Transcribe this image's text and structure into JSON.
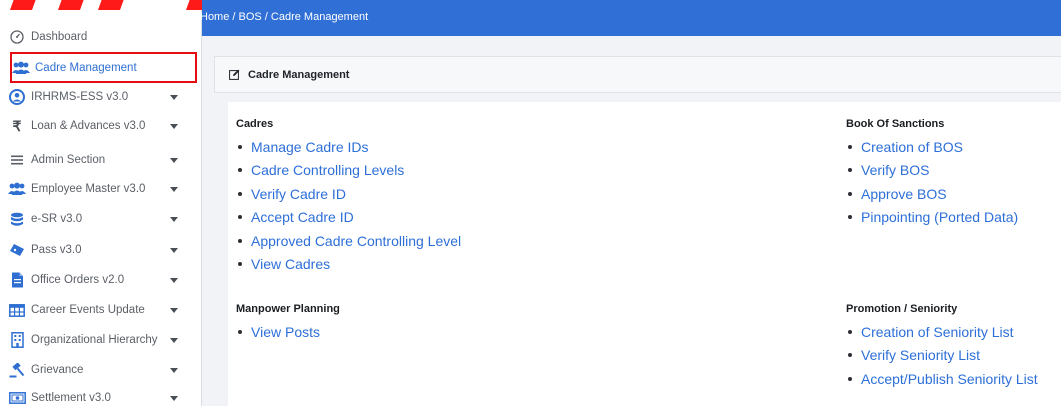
{
  "sidebar": {
    "items": [
      {
        "label": "Dashboard",
        "icon": "dashboard-icon",
        "has_caret": false,
        "active": false
      },
      {
        "label": "Cadre Management",
        "icon": "users-group-icon",
        "has_caret": false,
        "active": true
      },
      {
        "label": "IRHRMS-ESS v3.0",
        "icon": "user-circle-icon",
        "has_caret": true,
        "active": false
      },
      {
        "label": "Loan & Advances v3.0",
        "icon": "rupee-icon",
        "has_caret": true,
        "active": false
      },
      {
        "label": "Admin Section",
        "icon": "menu-bars-icon",
        "has_caret": true,
        "active": false
      },
      {
        "label": "Employee Master v3.0",
        "icon": "users-group-icon",
        "has_caret": true,
        "active": false
      },
      {
        "label": "e-SR v3.0",
        "icon": "database-icon",
        "has_caret": true,
        "active": false
      },
      {
        "label": "Pass v3.0",
        "icon": "ticket-icon",
        "has_caret": true,
        "active": false
      },
      {
        "label": "Office Orders v2.0",
        "icon": "file-icon",
        "has_caret": true,
        "active": false
      },
      {
        "label": "Career Events Update",
        "icon": "table-grid-icon",
        "has_caret": true,
        "active": false
      },
      {
        "label": "Organizational Hierarchy",
        "icon": "building-icon",
        "has_caret": true,
        "active": false
      },
      {
        "label": "Grievance",
        "icon": "gavel-icon",
        "has_caret": true,
        "active": false
      },
      {
        "label": "Settlement v3.0",
        "icon": "money-icon",
        "has_caret": true,
        "active": false
      }
    ]
  },
  "breadcrumb": "Home / BOS / Cadre Management",
  "panel": {
    "title": "Cadre Management",
    "icon": "edit-icon"
  },
  "sections": {
    "cadres": {
      "title": "Cadres",
      "links": [
        "Manage Cadre IDs",
        "Cadre Controlling Levels",
        "Verify Cadre ID",
        "Accept Cadre ID",
        "Approved Cadre Controlling Level",
        "View Cadres"
      ]
    },
    "book_of_sanctions": {
      "title": "Book Of Sanctions",
      "links": [
        "Creation of BOS",
        "Verify BOS",
        "Approve BOS",
        "Pinpointing (Ported Data)"
      ]
    },
    "manpower_planning": {
      "title": "Manpower Planning",
      "links": [
        "View Posts"
      ]
    },
    "promotion_seniority": {
      "title": "Promotion / Seniority",
      "links": [
        "Creation of Seniority List",
        "Verify Seniority List",
        "Accept/Publish Seniority List"
      ]
    }
  },
  "colors": {
    "topbar": "#2f6fd6",
    "link": "#2d6fd8",
    "active_outline": "#e30d12",
    "brand_accent": "#ff1a1a"
  }
}
